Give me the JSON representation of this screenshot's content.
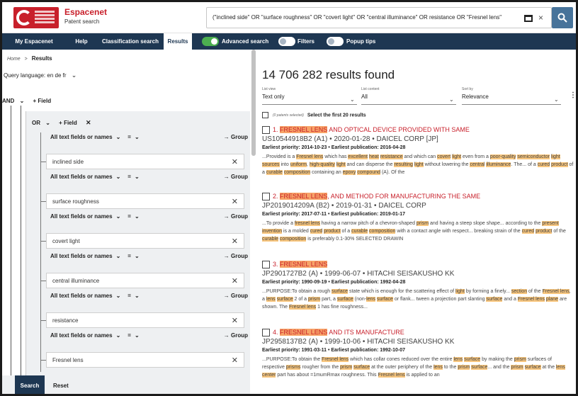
{
  "header": {
    "brand_name": "Espacenet",
    "brand_sub": "Patent search",
    "search_query": "(\"inclined side\" OR \"surface roughness\" OR \"covert light\" OR \"central illuminance\" OR resistance OR \"Fresnel lens\"",
    "clear_glyph": "×",
    "search_icon": "search-icon",
    "window_icon": "window-icon",
    "accent": "#c8202b"
  },
  "nav": {
    "items": [
      {
        "label": "My Espacenet"
      },
      {
        "label": "Help"
      },
      {
        "label": "Classification search"
      },
      {
        "label": "Results",
        "active": true
      }
    ],
    "toggles": [
      {
        "label": "Advanced search",
        "on": true
      },
      {
        "label": "Filters",
        "on": false
      },
      {
        "label": "Popup tips",
        "on": false
      }
    ],
    "bg_color": "#1e3752"
  },
  "left": {
    "breadcrumb_home": "Home",
    "breadcrumb_sep": ">",
    "breadcrumb_current": "Results",
    "query_language": "Query language: en de fr",
    "and_operator": "AND",
    "or_operator": "OR",
    "add_field": "+ Field",
    "remove_glyph": "✕",
    "chevron": "⌄",
    "fields": [
      {
        "scope": "All text fields or names",
        "op": "=",
        "group": "→ Group",
        "value": "inclined side"
      },
      {
        "scope": "All text fields or names",
        "op": "=",
        "group": "→ Group",
        "value": "surface roughness"
      },
      {
        "scope": "All text fields or names",
        "op": "=",
        "group": "→ Group",
        "value": "covert light"
      },
      {
        "scope": "All text fields or names",
        "op": "=",
        "group": "→ Group",
        "value": "central illuminance"
      },
      {
        "scope": "All text fields or names",
        "op": "=",
        "group": "→ Group",
        "value": "resistance"
      },
      {
        "scope": "All text fields or names",
        "op": "=",
        "group": "→ Group",
        "value": "Fresnel lens"
      }
    ],
    "search_button": "Search",
    "reset_button": "Reset"
  },
  "results": {
    "count_text": "14 706 282 results found",
    "list_view": {
      "label": "List view",
      "value": "Text only"
    },
    "list_content": {
      "label": "List content",
      "value": "All"
    },
    "sort_by": {
      "label": "Sort by",
      "value": "Relevance"
    },
    "menu_glyph": "⋮",
    "selected_text": "(0 patents selected)",
    "select_first": "Select the first 20 results",
    "items": [
      {
        "num": "1.",
        "title_pre": "",
        "title_hl": "FRESNEL LENS",
        "title_post": " AND OPTICAL DEVICE PROVIDED WITH SAME",
        "pub": "US10544918B2 (A1) • 2020-01-28 • DAICEL CORP [JP]",
        "priority": "Earliest priority: 2014-10-23 • Earliest publication: 2016-04-28",
        "abstract": "...Provided is a Fresnel lens which has excellent heat resistance and which can covert light even from a poor-quality semiconductor light sources into uniform, high-quality light and can disperse the resulting light without lowering the central illuminance. The... of a cured product of a curable composition containing an epoxy compound (A). Of the"
      },
      {
        "num": "2.",
        "title_pre": "",
        "title_hl": "FRESNEL LENS",
        "title_post": ", AND METHOD FOR MANUFACTURING THE SAME",
        "pub": "JP2019014209A (B2) • 2019-01-31 • DAICEL CORP",
        "priority": "Earliest priority: 2017-07-11 • Earliest publication: 2019-01-17",
        "abstract": "...To provide a fresnel lens having a narrow pitch of a chevron-shaped prism and having a steep slope shape... according to the present invention is a molded cured product of a curable composition with a contact angle with respect... breaking strain of the cured product of the curable composition is preferably 0.1-30% SELECTED DRAWIN"
      },
      {
        "num": "3.",
        "title_pre": "",
        "title_hl": "FRESNEL LENS",
        "title_post": "",
        "pub": "JP2901727B2 (A) • 1999-06-07 • HITACHI SEISAKUSHO KK",
        "priority": "Earliest priority: 1990-09-19 • Earliest publication: 1992-04-28",
        "abstract": "...PURPOSE:To obtain a rough surface state which is enough for the scattering effect of light by forming a finely... section of the Fresnel lens, a lens surface 2 of a prism part, a surface (non-lens surface or flank... tween a projection part slanting surface and a Fresnel lens plane are shown. The Fresnel lens 1 has fine roughness..."
      },
      {
        "num": "4.",
        "title_pre": "",
        "title_hl": "FRESNEL LENS",
        "title_post": " AND ITS MANUFACTURE",
        "pub": "JP2958137B2 (A) • 1999-10-06 • HITACHI SEISAKUSHO KK",
        "priority": "Earliest priority: 1991-03-11 • Earliest publication: 1992-10-07",
        "abstract": "...PURPOSE:To obtain the Fresnel lens which has collar cones reduced over the entire lens surface by making the prism surfaces of respective prisms rougher from the prism surface at the outer periphery of the lens to the prism surface... and the prism surface at the lens center part has about =1mumRmax roughness. This Fresnel lens is applied to an"
      }
    ],
    "highlight_color": "#f8c67e"
  }
}
